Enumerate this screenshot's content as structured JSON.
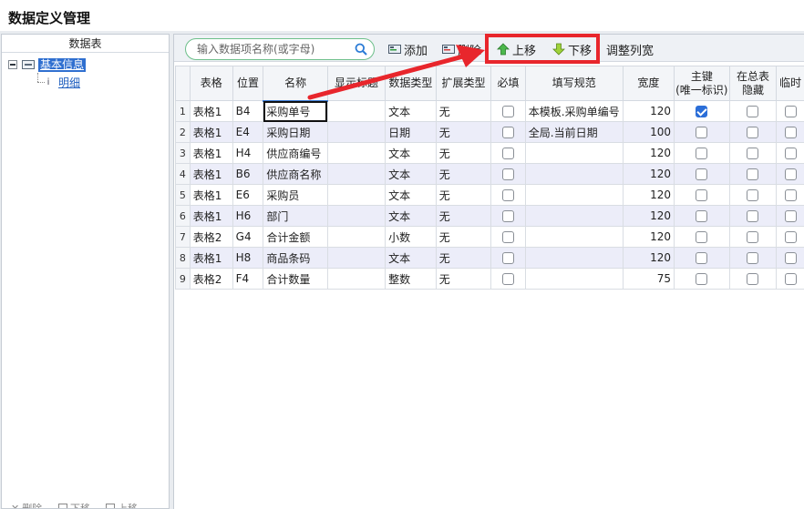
{
  "window": {
    "title": "数据定义管理"
  },
  "left_panel": {
    "header": "数据表",
    "tree": {
      "root_label": "基本信息",
      "child_label": "明细"
    },
    "footer": {
      "delete_label": "删除",
      "down_label": "下移",
      "up_label": "上移"
    }
  },
  "toolbar": {
    "search_placeholder": "输入数据项名称(或字母)",
    "add_label": "添加",
    "delete_label": "删除",
    "up_label": "上移",
    "down_label": "下移",
    "adjust_label": "调整列宽"
  },
  "grid": {
    "columns": [
      "表格",
      "位置",
      "名称",
      "显示标题",
      "数据类型",
      "扩展类型",
      "必填",
      "填写规范",
      "宽度",
      "主键\n(唯一标识)",
      "在总表\n隐藏",
      "临时"
    ],
    "rows": [
      {
        "n": "1",
        "table": "表格1",
        "pos": "B4",
        "name": "采购单号",
        "disp": "",
        "dtype": "文本",
        "ext": "无",
        "required": false,
        "rule": "本模板.采购单编号",
        "width": "120",
        "pk": true,
        "hidden": false,
        "temp": false
      },
      {
        "n": "2",
        "table": "表格1",
        "pos": "E4",
        "name": "采购日期",
        "disp": "",
        "dtype": "日期",
        "ext": "无",
        "required": false,
        "rule": "全局.当前日期",
        "width": "100",
        "pk": false,
        "hidden": false,
        "temp": false
      },
      {
        "n": "3",
        "table": "表格1",
        "pos": "H4",
        "name": "供应商编号",
        "disp": "",
        "dtype": "文本",
        "ext": "无",
        "required": false,
        "rule": "",
        "width": "120",
        "pk": false,
        "hidden": false,
        "temp": false
      },
      {
        "n": "4",
        "table": "表格1",
        "pos": "B6",
        "name": "供应商名称",
        "disp": "",
        "dtype": "文本",
        "ext": "无",
        "required": false,
        "rule": "",
        "width": "120",
        "pk": false,
        "hidden": false,
        "temp": false
      },
      {
        "n": "5",
        "table": "表格1",
        "pos": "E6",
        "name": "采购员",
        "disp": "",
        "dtype": "文本",
        "ext": "无",
        "required": false,
        "rule": "",
        "width": "120",
        "pk": false,
        "hidden": false,
        "temp": false
      },
      {
        "n": "6",
        "table": "表格1",
        "pos": "H6",
        "name": "部门",
        "disp": "",
        "dtype": "文本",
        "ext": "无",
        "required": false,
        "rule": "",
        "width": "120",
        "pk": false,
        "hidden": false,
        "temp": false
      },
      {
        "n": "7",
        "table": "表格2",
        "pos": "G4",
        "name": "合计金额",
        "disp": "",
        "dtype": "小数",
        "ext": "无",
        "required": false,
        "rule": "",
        "width": "120",
        "pk": false,
        "hidden": false,
        "temp": false
      },
      {
        "n": "8",
        "table": "表格1",
        "pos": "H8",
        "name": "商品条码",
        "disp": "",
        "dtype": "文本",
        "ext": "无",
        "required": false,
        "rule": "",
        "width": "120",
        "pk": false,
        "hidden": false,
        "temp": false
      },
      {
        "n": "9",
        "table": "表格2",
        "pos": "F4",
        "name": "合计数量",
        "disp": "",
        "dtype": "整数",
        "ext": "无",
        "required": false,
        "rule": "",
        "width": "75",
        "pk": false,
        "hidden": false,
        "temp": false
      }
    ]
  },
  "colors": {
    "highlight": "#e8262c",
    "accent_up": "#3aa33a",
    "tree_selected": "#2f6fd0",
    "alt_row": "#ecedf9"
  }
}
